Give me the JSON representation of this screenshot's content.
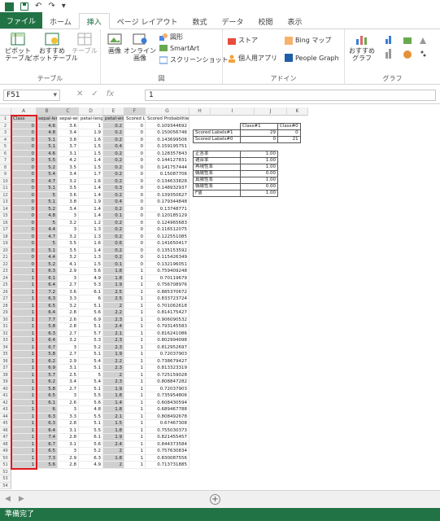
{
  "quick_access": {
    "undo_glyph": "↶",
    "redo_glyph": "↷",
    "more_glyph": "▾"
  },
  "tabs": [
    "ファイル",
    "ホーム",
    "挿入",
    "ページ レイアウト",
    "数式",
    "データ",
    "校閲",
    "表示"
  ],
  "ribbon": {
    "pivot_label": "ピボット\nテーブル",
    "recommended_pivot_label": "おすすめ\nピボットテーブル",
    "table_label": "テーブル",
    "group_table": "テーブル",
    "image_label": "画像",
    "online_image_label": "オンライン\n画像",
    "shapes_label": "図形",
    "smartart_label": "SmartArt",
    "screenshot_label": "スクリーンショット",
    "group_figure": "図",
    "store_label": "ストア",
    "personal_apps_label": "個人用アプリ",
    "bing_maps_label": "Bing マップ",
    "people_graph_label": "People Graph",
    "group_addin": "アドイン",
    "recommended_graph_label": "おすすめ\nグラフ",
    "group_graph": "グラフ"
  },
  "formula_bar": {
    "name_box": "F51",
    "formula": "1",
    "cancel": "✕",
    "confirm": "✓",
    "fx": "fx"
  },
  "columns": [
    "A",
    "B",
    "C",
    "D",
    "E",
    "F",
    "G",
    "H",
    "I",
    "J",
    "K"
  ],
  "headers": [
    "Class",
    "sepal-length",
    "sepal-width",
    "petal-length",
    "petal-width",
    "Scored Labels",
    "Scored Probabilities"
  ],
  "rows": [
    [
      "0",
      "4.6",
      "3.6",
      "1",
      "0.2",
      "0",
      "0.109344692"
    ],
    [
      "0",
      "4.8",
      "3.4",
      "1.9",
      "0.2",
      "0",
      "0.150056746"
    ],
    [
      "0",
      "5.1",
      "3.8",
      "1.6",
      "0.2",
      "0",
      "0.143699506"
    ],
    [
      "0",
      "5.1",
      "3.7",
      "1.5",
      "0.4",
      "0",
      "0.159195751"
    ],
    [
      "0",
      "4.6",
      "3.1",
      "1.5",
      "0.2",
      "0",
      "0.128357843"
    ],
    [
      "0",
      "5.5",
      "4.2",
      "1.4",
      "0.2",
      "0",
      "0.144127831"
    ],
    [
      "0",
      "5.2",
      "3.5",
      "1.5",
      "0.2",
      "0",
      "0.141757444"
    ],
    [
      "0",
      "5.4",
      "3.4",
      "1.7",
      "0.2",
      "0",
      "0.15087706"
    ],
    [
      "0",
      "4.7",
      "3.2",
      "1.6",
      "0.2",
      "0",
      "0.134633828"
    ],
    [
      "0",
      "5.1",
      "3.5",
      "1.4",
      "0.3",
      "0",
      "0.148932937"
    ],
    [
      "0",
      "5",
      "3.6",
      "1.4",
      "0.2",
      "0",
      "0.139350627"
    ],
    [
      "0",
      "5.1",
      "3.8",
      "1.9",
      "0.4",
      "0",
      "0.179344848"
    ],
    [
      "0",
      "5.2",
      "3.4",
      "1.4",
      "0.2",
      "0",
      "0.13748771"
    ],
    [
      "0",
      "4.8",
      "3",
      "1.4",
      "0.1",
      "0",
      "0.120185129"
    ],
    [
      "0",
      "5",
      "3.2",
      "1.2",
      "0.2",
      "0",
      "0.124965683"
    ],
    [
      "0",
      "4.4",
      "3",
      "1.3",
      "0.2",
      "0",
      "0.116512075"
    ],
    [
      "0",
      "4.7",
      "3.2",
      "1.3",
      "0.2",
      "0",
      "0.122551085"
    ],
    [
      "0",
      "5",
      "3.5",
      "1.6",
      "0.6",
      "0",
      "0.141650417"
    ],
    [
      "0",
      "5.1",
      "3.5",
      "1.4",
      "0.2",
      "0",
      "0.135153592"
    ],
    [
      "0",
      "4.4",
      "3.2",
      "1.3",
      "0.2",
      "0",
      "0.115426349"
    ],
    [
      "0",
      "5.2",
      "4.1",
      "1.5",
      "0.1",
      "0",
      "0.132196051"
    ],
    [
      "1",
      "6.3",
      "2.9",
      "5.6",
      "1.8",
      "1",
      "0.759409248"
    ],
    [
      "1",
      "6.1",
      "3",
      "4.9",
      "1.8",
      "1",
      "0.70119679"
    ],
    [
      "1",
      "6.4",
      "2.7",
      "5.3",
      "1.9",
      "1",
      "0.756708976"
    ],
    [
      "1",
      "7.2",
      "3.6",
      "6.1",
      "2.5",
      "1",
      "0.885370672"
    ],
    [
      "1",
      "6.3",
      "3.3",
      "6",
      "2.5",
      "1",
      "0.833723724"
    ],
    [
      "1",
      "6.5",
      "3.2",
      "5.1",
      "2",
      "1",
      "0.701062618"
    ],
    [
      "1",
      "6.4",
      "2.8",
      "5.6",
      "2.2",
      "1",
      "0.814175427"
    ],
    [
      "1",
      "7.7",
      "2.6",
      "6.9",
      "2.3",
      "1",
      "0.906090532"
    ],
    [
      "1",
      "5.8",
      "2.8",
      "5.1",
      "2.4",
      "1",
      "0.793145583"
    ],
    [
      "1",
      "6.3",
      "2.7",
      "5.7",
      "2.1",
      "1",
      "0.816241086"
    ],
    [
      "1",
      "6.4",
      "3.2",
      "5.3",
      "2.3",
      "1",
      "0.802994098"
    ],
    [
      "1",
      "6.7",
      "3",
      "5.2",
      "2.3",
      "1",
      "0.812952697"
    ],
    [
      "1",
      "5.8",
      "2.7",
      "5.1",
      "1.9",
      "1",
      "0.72037903"
    ],
    [
      "1",
      "6.2",
      "2.9",
      "5.4",
      "2.2",
      "1",
      "0.738679427"
    ],
    [
      "1",
      "6.9",
      "3.1",
      "5.1",
      "2.3",
      "1",
      "0.813323319"
    ],
    [
      "1",
      "5.7",
      "2.5",
      "5",
      "2",
      "1",
      "0.725159028"
    ],
    [
      "1",
      "6.2",
      "3.4",
      "5.4",
      "2.3",
      "1",
      "0.808847282"
    ],
    [
      "1",
      "5.8",
      "2.7",
      "5.1",
      "1.9",
      "1",
      "0.72037903"
    ],
    [
      "1",
      "6.5",
      "3",
      "5.5",
      "1.8",
      "1",
      "0.735954806"
    ],
    [
      "1",
      "6.1",
      "2.6",
      "5.6",
      "1.4",
      "1",
      "0.608430594"
    ],
    [
      "1",
      "6",
      "3",
      "4.8",
      "1.8",
      "1",
      "0.689467788"
    ],
    [
      "1",
      "6.3",
      "3.3",
      "5.5",
      "2.1",
      "1",
      "0.808492678"
    ],
    [
      "1",
      "6.3",
      "2.8",
      "5.1",
      "1.5",
      "1",
      "0.67467308"
    ],
    [
      "1",
      "6.4",
      "3.1",
      "5.5",
      "1.8",
      "1",
      "0.755030373"
    ],
    [
      "1",
      "7.4",
      "2.8",
      "6.1",
      "1.9",
      "1",
      "0.821455457"
    ],
    [
      "1",
      "6.7",
      "3.1",
      "5.6",
      "2.4",
      "1",
      "0.844373584"
    ],
    [
      "1",
      "6.5",
      "3",
      "5.2",
      "2",
      "1",
      "0.757630834"
    ],
    [
      "1",
      "7.3",
      "2.9",
      "6.3",
      "1.8",
      "1",
      "0.830087556"
    ],
    [
      "1",
      "5.6",
      "2.8",
      "4.9",
      "2",
      "1",
      "0.713731885"
    ]
  ],
  "confusion": {
    "col_headers": [
      "Class#1",
      "Class#0"
    ],
    "rows": [
      [
        "Scored Labels#1",
        "29",
        "0"
      ],
      [
        "Scored Labels#0",
        "0",
        "21"
      ]
    ]
  },
  "metrics": [
    [
      "正答率",
      "1.00"
    ],
    [
      "適合率",
      "1.00"
    ],
    [
      "再現性率",
      "1.00"
    ],
    [
      "偽陽性率",
      "0.00"
    ],
    [
      "真陽性率",
      "1.00"
    ],
    [
      "偽陽性率",
      "0.00"
    ],
    [
      "F値",
      "1.00"
    ]
  ],
  "status": "準備完了",
  "add_sheet_glyph": "+",
  "sheet_nav": [
    "◀",
    "▶"
  ]
}
